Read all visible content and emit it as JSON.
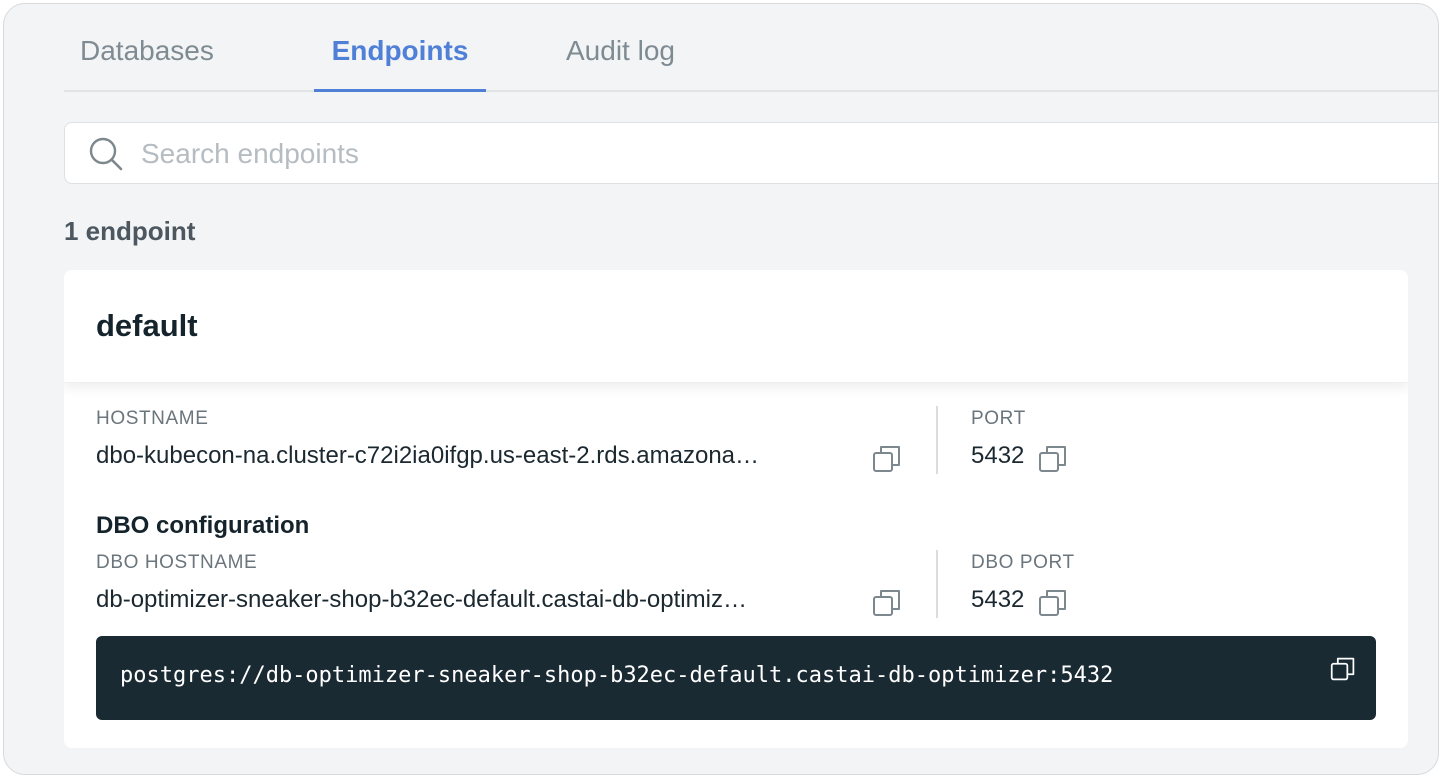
{
  "tabs": [
    {
      "label": "Databases",
      "active": false
    },
    {
      "label": "Endpoints",
      "active": true
    },
    {
      "label": "Audit log",
      "active": false
    }
  ],
  "search": {
    "placeholder": "Search endpoints",
    "value": ""
  },
  "endpoint_count": "1 endpoint",
  "endpoint": {
    "name": "default",
    "hostname_label": "HOSTNAME",
    "hostname": "dbo-kubecon-na.cluster-c72i2ia0ifgp.us-east-2.rds.amazona…",
    "port_label": "PORT",
    "port": "5432",
    "dbo_section_title": "DBO configuration",
    "dbo_hostname_label": "DBO HOSTNAME",
    "dbo_hostname": "db-optimizer-sneaker-shop-b32ec-default.castai-db-optimiz…",
    "dbo_port_label": "DBO PORT",
    "dbo_port": "5432",
    "connection_string": "postgres://db-optimizer-sneaker-shop-b32ec-default.castai-db-optimizer:5432"
  },
  "colors": {
    "accent": "#4f7fd6",
    "code_background": "#1a2a33",
    "page_background": "#f2f4f5"
  },
  "icons": [
    "search-icon",
    "copy-icon"
  ]
}
